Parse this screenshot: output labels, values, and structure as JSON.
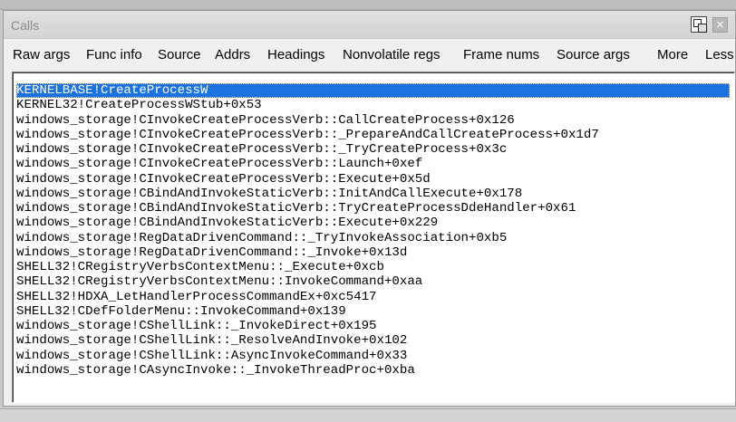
{
  "window": {
    "title": "Calls",
    "float_icon": "float-window-icon",
    "close_icon": "close-icon",
    "close_glyph": "×"
  },
  "toolbar": {
    "buttons": [
      {
        "label": "Raw args"
      },
      {
        "label": "Func info"
      },
      {
        "label": "Source"
      },
      {
        "label": "Addrs"
      },
      {
        "label": "Headings"
      },
      {
        "label": "Nonvolatile regs"
      },
      {
        "label": "Frame nums"
      },
      {
        "label": "Source args"
      },
      {
        "label": "More"
      },
      {
        "label": "Less"
      }
    ]
  },
  "stack": {
    "selected_index": 0,
    "selected_color": "#1b72e0",
    "frames": [
      "KERNELBASE!CreateProcessW",
      "KERNEL32!CreateProcessWStub+0x53",
      "windows_storage!CInvokeCreateProcessVerb::CallCreateProcess+0x126",
      "windows_storage!CInvokeCreateProcessVerb::_PrepareAndCallCreateProcess+0x1d7",
      "windows_storage!CInvokeCreateProcessVerb::_TryCreateProcess+0x3c",
      "windows_storage!CInvokeCreateProcessVerb::Launch+0xef",
      "windows_storage!CInvokeCreateProcessVerb::Execute+0x5d",
      "windows_storage!CBindAndInvokeStaticVerb::InitAndCallExecute+0x178",
      "windows_storage!CBindAndInvokeStaticVerb::TryCreateProcessDdeHandler+0x61",
      "windows_storage!CBindAndInvokeStaticVerb::Execute+0x229",
      "windows_storage!RegDataDrivenCommand::_TryInvokeAssociation+0xb5",
      "windows_storage!RegDataDrivenCommand::_Invoke+0x13d",
      "SHELL32!CRegistryVerbsContextMenu::_Execute+0xcb",
      "SHELL32!CRegistryVerbsContextMenu::InvokeCommand+0xaa",
      "SHELL32!HDXA_LetHandlerProcessCommandEx+0xc5417",
      "SHELL32!CDefFolderMenu::InvokeCommand+0x139",
      "windows_storage!CShellLink::_InvokeDirect+0x195",
      "windows_storage!CShellLink::_ResolveAndInvoke+0x102",
      "windows_storage!CShellLink::AsyncInvokeCommand+0x33",
      "windows_storage!CAsyncInvoke::_InvokeThreadProc+0xba"
    ]
  }
}
